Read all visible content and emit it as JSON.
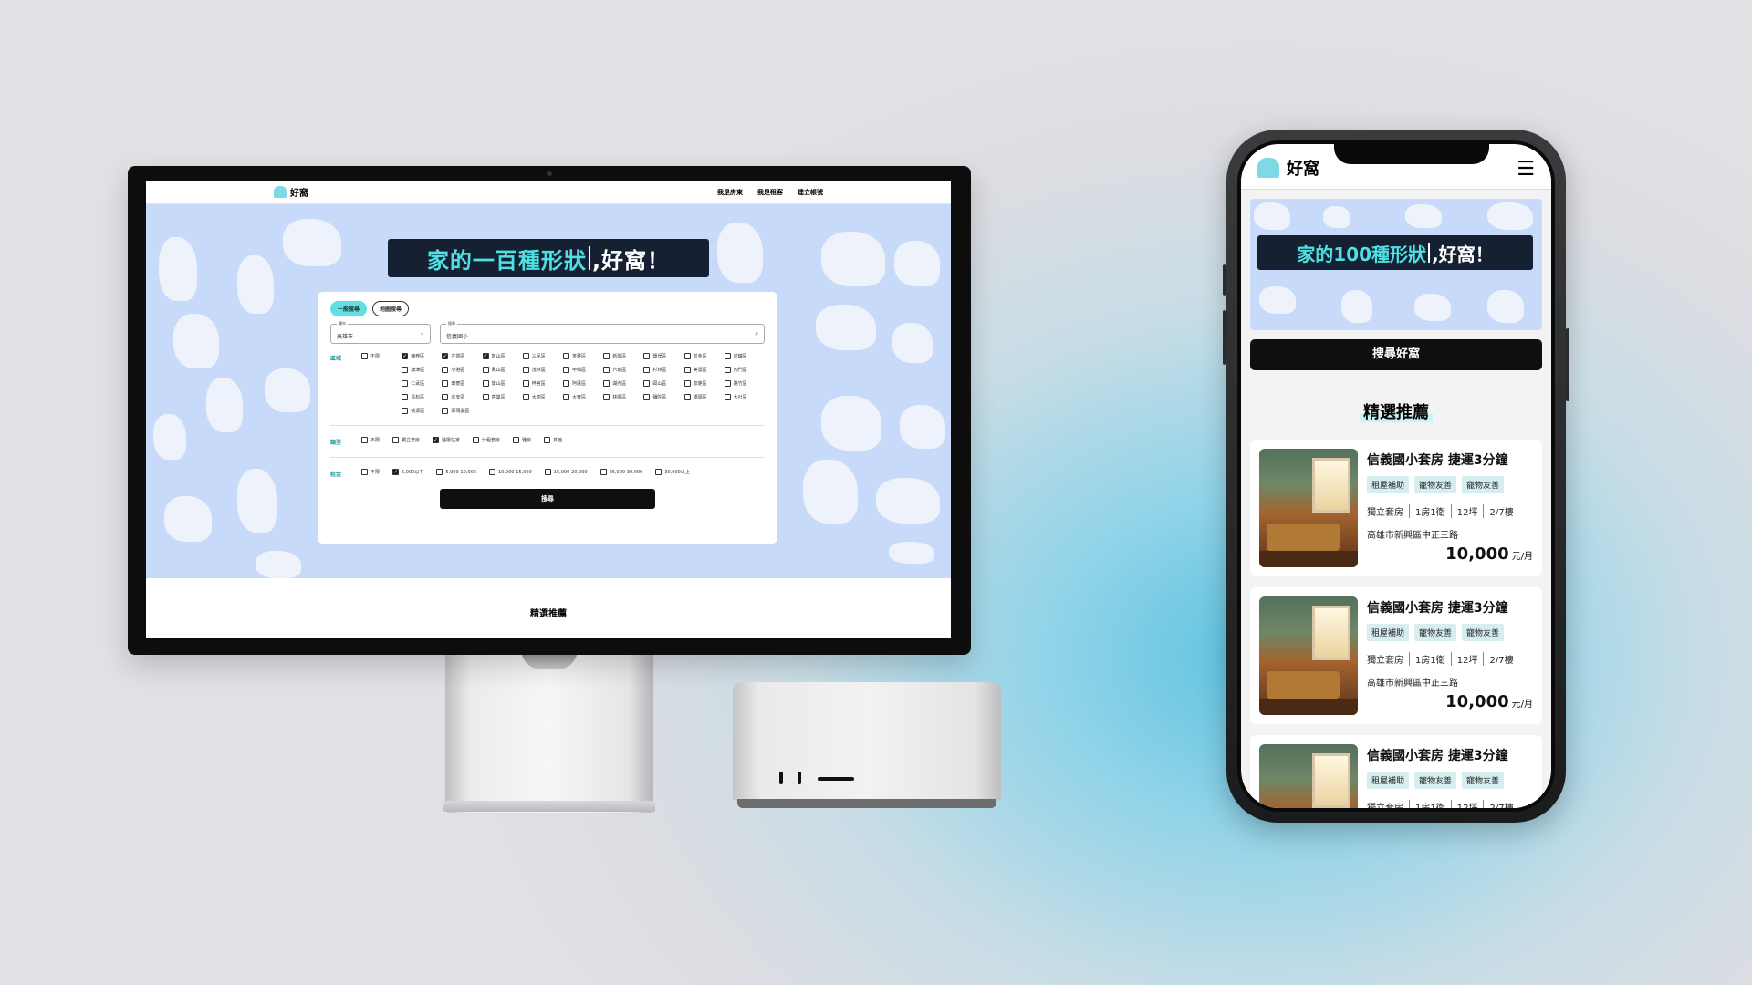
{
  "brand": {
    "name": "好窩",
    "accent": "#4fe0e4",
    "hero_bg": "#c8daf9",
    "dark": "#152032"
  },
  "desktop": {
    "nav": {
      "links": [
        "我是房東",
        "我是租客",
        "建立帳號"
      ]
    },
    "headline": {
      "part_a": "家的一百種形狀",
      "part_b": ",好窩！"
    },
    "tabs": [
      "一般搜尋",
      "地圖搜尋"
    ],
    "city": {
      "label": "縣市",
      "value": "高雄市"
    },
    "keyword": {
      "label": "搜尋",
      "value": "信義國小"
    },
    "district": {
      "label": "區域",
      "options": [
        {
          "t": "不限",
          "on": false
        },
        {
          "t": "楠梓區",
          "on": true
        },
        {
          "t": "左營區",
          "on": true
        },
        {
          "t": "鼓山區",
          "on": true
        },
        {
          "t": "三民區",
          "on": false
        },
        {
          "t": "苓雅區",
          "on": false
        },
        {
          "t": "新興區",
          "on": false
        },
        {
          "t": "鹽埕區",
          "on": false
        },
        {
          "t": "前金區",
          "on": false
        },
        {
          "t": "前鎮區",
          "on": false
        },
        {
          "t": "",
          "on": null
        },
        {
          "t": "旗津區",
          "on": false
        },
        {
          "t": "小港區",
          "on": false
        },
        {
          "t": "鳳山區",
          "on": false
        },
        {
          "t": "茂林區",
          "on": false
        },
        {
          "t": "甲仙區",
          "on": false
        },
        {
          "t": "六龜區",
          "on": false
        },
        {
          "t": "杉林區",
          "on": false
        },
        {
          "t": "美濃區",
          "on": false
        },
        {
          "t": "內門區",
          "on": false
        },
        {
          "t": "",
          "on": null
        },
        {
          "t": "仁武區",
          "on": false
        },
        {
          "t": "田寮區",
          "on": false
        },
        {
          "t": "旗山區",
          "on": false
        },
        {
          "t": "梓官區",
          "on": false
        },
        {
          "t": "阿蓮區",
          "on": false
        },
        {
          "t": "湖內區",
          "on": false
        },
        {
          "t": "岡山區",
          "on": false
        },
        {
          "t": "茄萣區",
          "on": false
        },
        {
          "t": "路竹區",
          "on": false
        },
        {
          "t": "",
          "on": null
        },
        {
          "t": "鳥松區",
          "on": false
        },
        {
          "t": "永安區",
          "on": false
        },
        {
          "t": "燕巢區",
          "on": false
        },
        {
          "t": "大樹區",
          "on": false
        },
        {
          "t": "大寮區",
          "on": false
        },
        {
          "t": "林園區",
          "on": false
        },
        {
          "t": "彌陀區",
          "on": false
        },
        {
          "t": "橋頭區",
          "on": false
        },
        {
          "t": "大社區",
          "on": false
        },
        {
          "t": "",
          "on": null
        },
        {
          "t": "桃源區",
          "on": false
        },
        {
          "t": "那瑪夏區",
          "on": false
        }
      ]
    },
    "type": {
      "label": "類型",
      "options": [
        {
          "t": "不限",
          "on": false
        },
        {
          "t": "獨立套房",
          "on": false
        },
        {
          "t": "整層住家",
          "on": true
        },
        {
          "t": "分租套房",
          "on": false
        },
        {
          "t": "雅房",
          "on": false
        },
        {
          "t": "其他",
          "on": false
        }
      ]
    },
    "rent": {
      "label": "租金",
      "options": [
        {
          "t": "不限",
          "on": false
        },
        {
          "t": "5,000以下",
          "on": true
        },
        {
          "t": "5,000-10,000",
          "on": false
        },
        {
          "t": "10,000-15,000",
          "on": false
        },
        {
          "t": "15,000-20,000",
          "on": false
        },
        {
          "t": "25,000-30,000",
          "on": false
        },
        {
          "t": "30,000以上",
          "on": false
        }
      ]
    },
    "submit": "搜尋",
    "featured": "精選推薦"
  },
  "mobile": {
    "headline": {
      "part_a": "家的100種形狀",
      "part_b": ",好窩！"
    },
    "search_button": "搜尋好窩",
    "featured": "精選推薦",
    "listings": [
      {
        "title": "信義國小套房 捷運3分鐘",
        "tags": [
          "租屋補助",
          "寵物友善",
          "寵物友善"
        ],
        "specs": [
          "獨立套房",
          "1房1衛",
          "12坪",
          "2/7樓"
        ],
        "address": "高雄市新興區中正三路",
        "price": "10,000",
        "unit": "元/月"
      },
      {
        "title": "信義國小套房 捷運3分鐘",
        "tags": [
          "租屋補助",
          "寵物友善",
          "寵物友善"
        ],
        "specs": [
          "獨立套房",
          "1房1衛",
          "12坪",
          "2/7樓"
        ],
        "address": "高雄市新興區中正三路",
        "price": "10,000",
        "unit": "元/月"
      },
      {
        "title": "信義國小套房 捷運3分鐘",
        "tags": [
          "租屋補助",
          "寵物友善",
          "寵物友善"
        ],
        "specs": [
          "獨立套房",
          "1房1衛",
          "12坪",
          "2/7樓"
        ],
        "address": "",
        "price": "",
        "unit": ""
      }
    ]
  }
}
